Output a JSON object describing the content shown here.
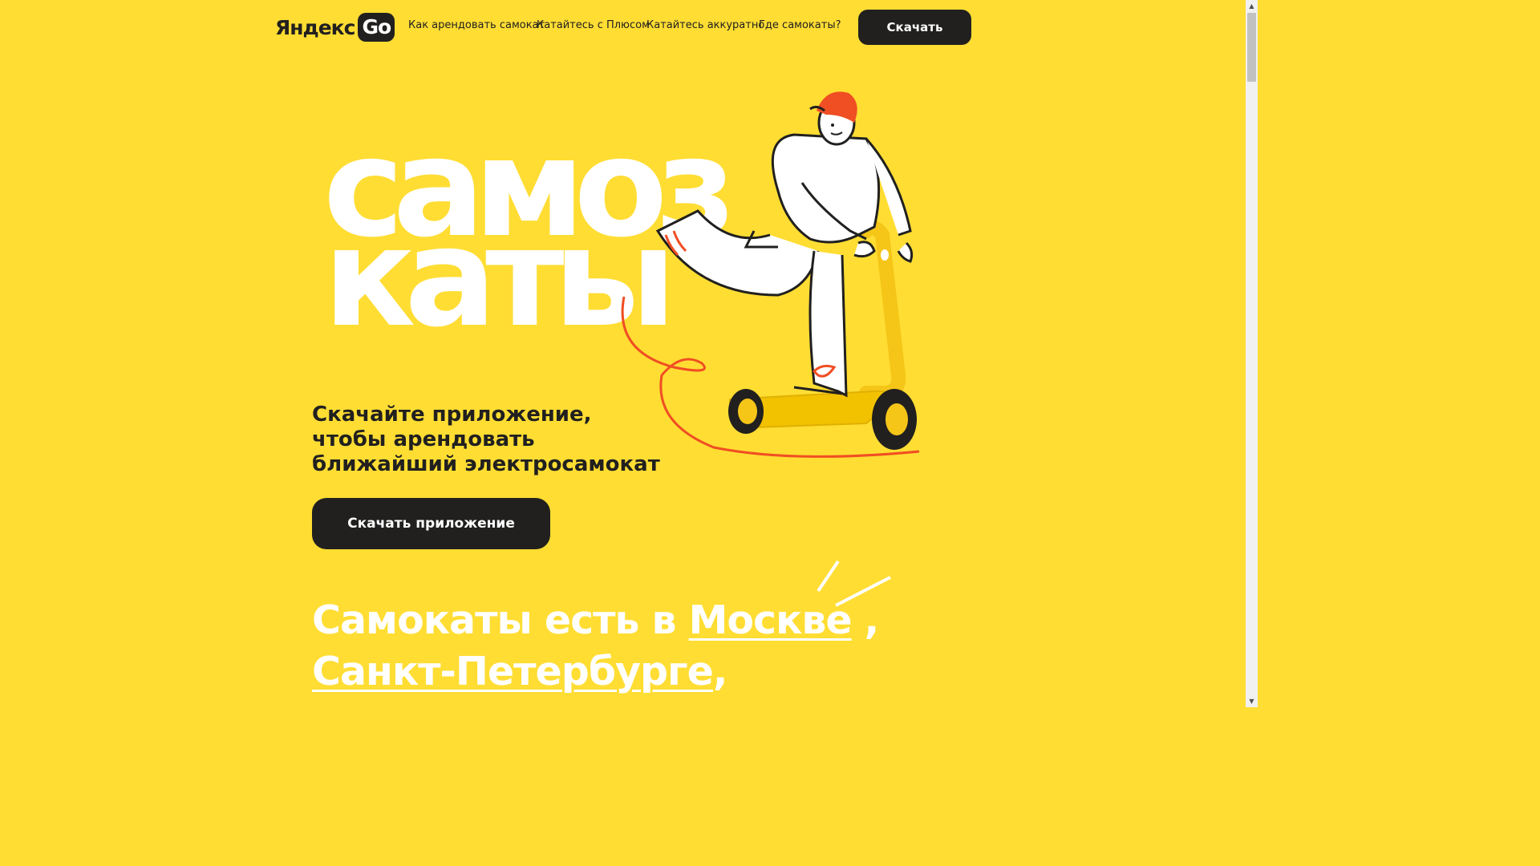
{
  "header": {
    "logo_text": "Яндекс",
    "logo_go": "Go",
    "nav": [
      "Как арендовать самокат",
      "Катайтесь с Плюсом",
      "Катайтесь аккуратно",
      "Где самокаты?"
    ],
    "download_label": "Скачать"
  },
  "hero": {
    "word_line1": "самоз",
    "word_line2": "каты",
    "subtitle_lines": [
      "Скачайте приложение,",
      "чтобы арендовать",
      "ближайший электросамокат"
    ],
    "app_button_label": "Скачать приложение"
  },
  "cities": {
    "prefix": "Самокаты есть в ",
    "city1": "Москве",
    "sep1": " ,",
    "city2": "Санкт-Петербурге",
    "sep2": ","
  },
  "icons": {
    "logo": "yandex-go-logo",
    "illustration": "person-on-scooter-illustration",
    "sparks": "spark-lines-decoration"
  },
  "colors": {
    "background": "#FFDD33",
    "dark": "#21201f",
    "accent_red": "#F04E23",
    "white": "#FFFFFF"
  }
}
